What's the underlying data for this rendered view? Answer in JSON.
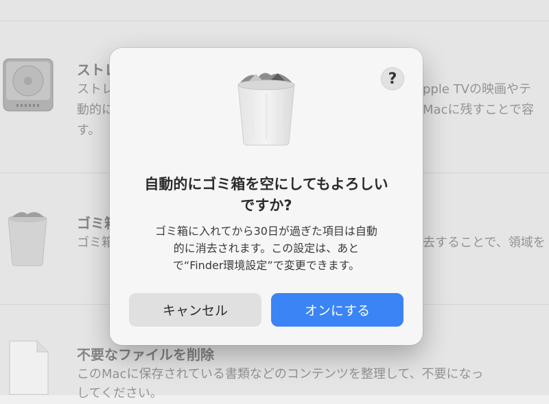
{
  "background": {
    "section1": {
      "title": "ストレ",
      "line1": "ストレ",
      "line2": "動的に",
      "line3": "す。",
      "right1": "pple TVの映画やテ",
      "right2": "Macに残すことで容"
    },
    "section2": {
      "title": "ゴミ箱",
      "line1": "ゴミ箱",
      "right1": "去することで、領域を"
    },
    "section3": {
      "title": "不要なファイルを削除",
      "line1": "このMacに保存されている書類などのコンテンツを整理して、不要になっ",
      "line2": "してください。"
    }
  },
  "dialog": {
    "help_label": "?",
    "title_line1": "自動的にゴミ箱を空にしてもよろしい",
    "title_line2": "ですか?",
    "message_line1": "ゴミ箱に入れてから30日が過ぎた項目は自動",
    "message_line2": "的に消去されます。この設定は、あと",
    "message_line3": "で“Finder環境設定”で変更できます。",
    "cancel_label": "キャンセル",
    "confirm_label": "オンにする"
  },
  "icons": {
    "hard_drive": "hard-drive-icon",
    "trash": "trash-full-icon",
    "document": "document-icon",
    "help": "help-icon"
  },
  "colors": {
    "accent": "#3b84f5",
    "dialog_bg": "#f6f6f6",
    "cancel_bg": "#e0e0e0"
  }
}
